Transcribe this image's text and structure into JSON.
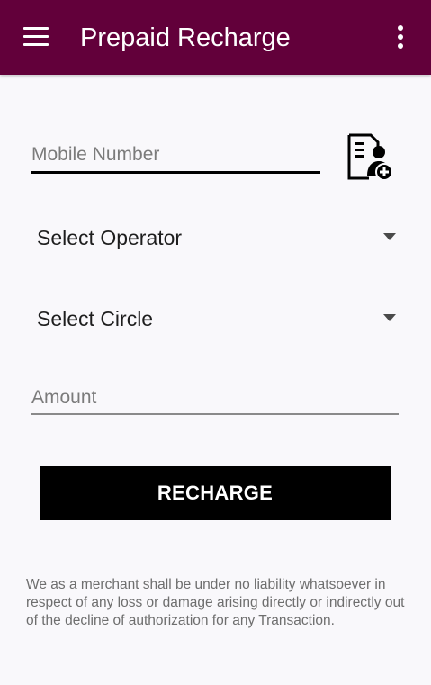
{
  "app_bar": {
    "title": "Prepaid Recharge",
    "menu_icon": "hamburger-menu-icon",
    "overflow_icon": "more-vert-icon",
    "background_color": "#62003a"
  },
  "form": {
    "mobile_number": {
      "placeholder": "Mobile Number",
      "value": ""
    },
    "contact_icon": "contact-picker-icon",
    "operator_select": {
      "selected": "Select Operator"
    },
    "circle_select": {
      "selected": "Select Circle"
    },
    "amount": {
      "placeholder": "Amount",
      "value": ""
    },
    "recharge_button_label": "RECHARGE"
  },
  "disclaimer": "We as a merchant shall be under no liability whatsoever in respect of any loss or damage arising directly or indirectly out of the decline of authorization for any Transaction."
}
